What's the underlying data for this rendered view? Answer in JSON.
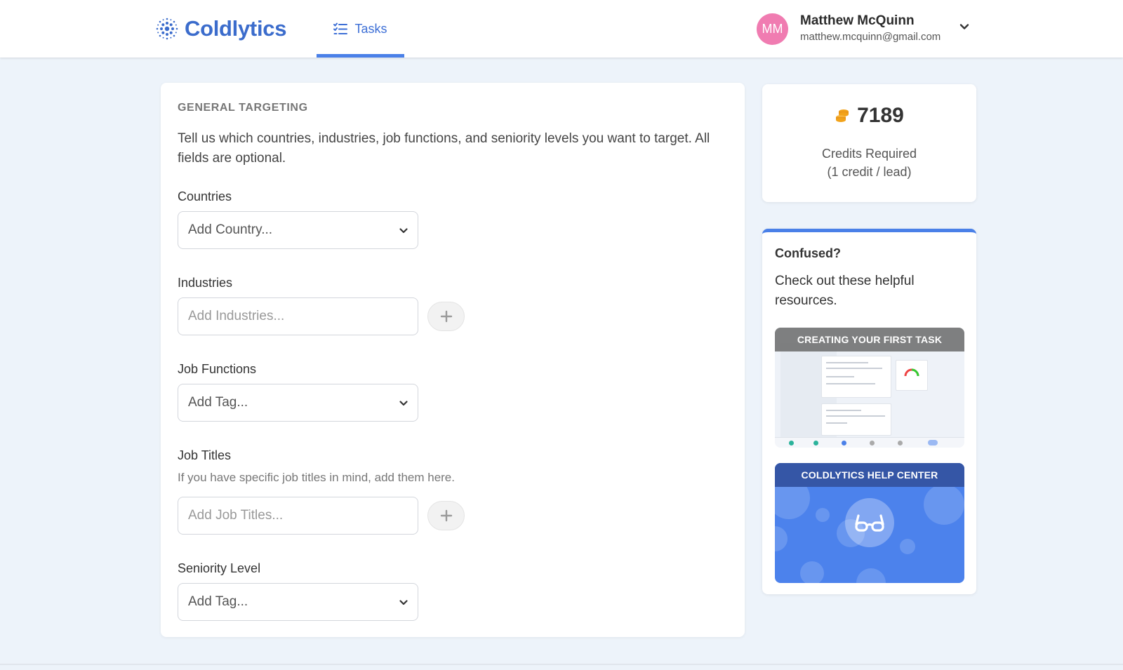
{
  "header": {
    "brand": "Coldlytics",
    "nav": {
      "tasks_label": "Tasks"
    },
    "user": {
      "initials": "MM",
      "name": "Matthew McQuinn",
      "email": "matthew.mcquinn@gmail.com",
      "avatar_color": "#f07cb1"
    }
  },
  "targeting": {
    "section_title": "GENERAL TARGETING",
    "description": "Tell us which countries, industries, job functions, and seniority levels you want to target. All fields are optional.",
    "countries": {
      "label": "Countries",
      "placeholder": "Add Country..."
    },
    "industries": {
      "label": "Industries",
      "placeholder": "Add Industries..."
    },
    "job_functions": {
      "label": "Job Functions",
      "placeholder": "Add Tag..."
    },
    "job_titles": {
      "label": "Job Titles",
      "hint": "If you have specific job titles in mind, add them here.",
      "placeholder": "Add Job Titles..."
    },
    "seniority": {
      "label": "Seniority Level",
      "placeholder": "Add Tag..."
    }
  },
  "credits": {
    "value": "7189",
    "label_line1": "Credits Required",
    "label_line2": "(1 credit / lead)",
    "icon": "coins-icon"
  },
  "help": {
    "title": "Confused?",
    "description": "Check out these helpful resources.",
    "resources": [
      {
        "title": "CREATING YOUR FIRST TASK"
      },
      {
        "title": "COLDLYTICS HELP CENTER",
        "icon": "glasses-icon"
      }
    ]
  },
  "colors": {
    "accent": "#4a80e8",
    "brand": "#3b6ccc",
    "background": "#edf3fa",
    "coin": "#f2a31b"
  }
}
